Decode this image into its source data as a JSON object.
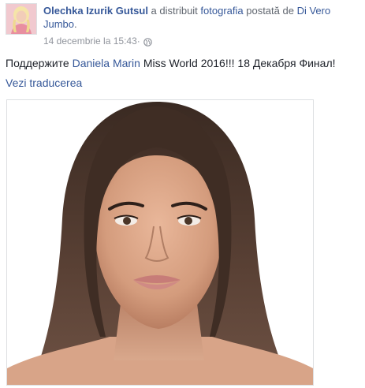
{
  "post": {
    "author": "Olechka Izurik Gutsul",
    "shared_text": " a distribuit ",
    "shared_object": "fotografia",
    "posted_by_text": " postată de ",
    "original_author": "Di Vero Jumbo",
    "original_author_suffix": ".",
    "timestamp": "14 decembrie la 15:43",
    "separator": " · ",
    "privacy_icon": "globe-icon",
    "message_prefix": "Поддержите ",
    "message_tag": "Daniela Marin",
    "message_suffix": " Miss World 2016!!! 18 Декабря Финал!",
    "see_translation": "Vezi traducerea",
    "photo_subject": "portrait photo"
  },
  "colors": {
    "link": "#365899",
    "meta": "#90949c",
    "text": "#1d2129",
    "border": "#dddfe2"
  }
}
